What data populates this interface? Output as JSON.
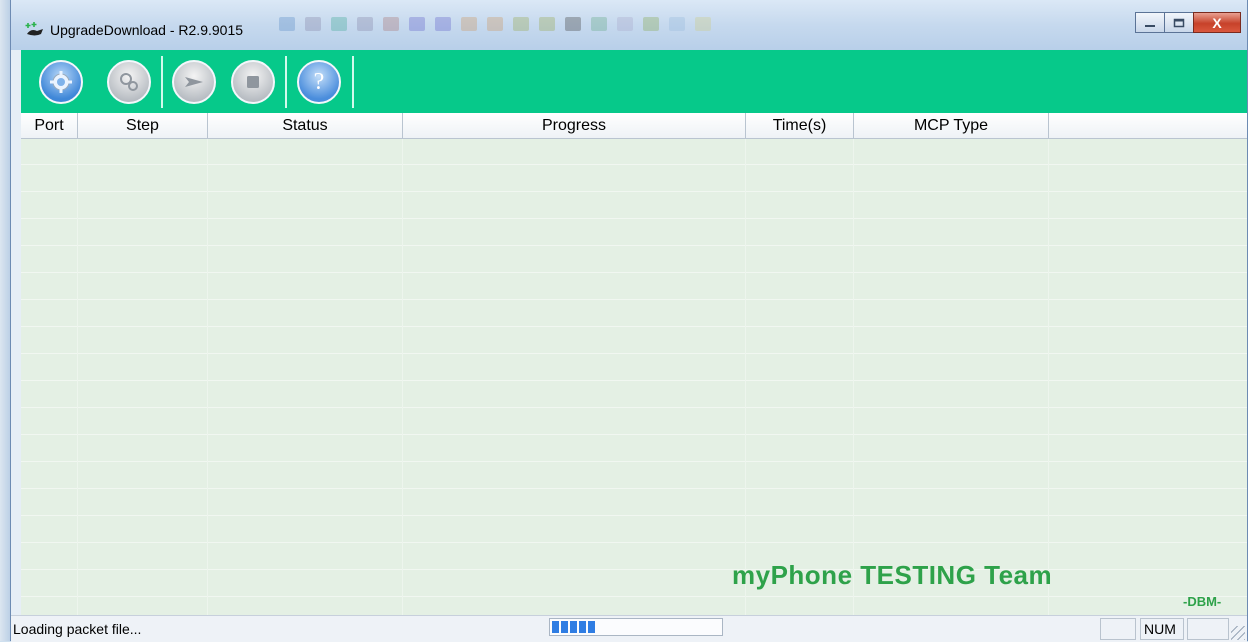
{
  "window": {
    "title": "UpgradeDownload - R2.9.9015",
    "buttons": {
      "minimize_icon": "minimize-icon",
      "maximize_icon": "maximize-icon",
      "close_label": "X"
    }
  },
  "toolbar": {
    "buttons": [
      {
        "name": "settings",
        "icon": "gear-icon"
      },
      {
        "name": "advanced-settings",
        "icon": "gears-icon"
      },
      {
        "name": "start",
        "icon": "play-icon"
      },
      {
        "name": "stop",
        "icon": "stop-icon"
      },
      {
        "name": "help",
        "icon": "question-icon",
        "label": "?"
      }
    ]
  },
  "table": {
    "columns": [
      "Port",
      "Step",
      "Status",
      "Progress",
      "Time(s)",
      "MCP Type",
      ""
    ],
    "rows": []
  },
  "watermark": {
    "text": "myPhone TESTING Team",
    "signature": "-DBM-"
  },
  "statusbar": {
    "message": "Loading packet file...",
    "progress_fraction": 0.25,
    "panes": [
      "",
      "NUM",
      ""
    ]
  },
  "colors": {
    "toolbar": "#06c98a",
    "grid": "#e4f0e4",
    "watermark": "#2ea24a",
    "progress": "#2f7de3"
  }
}
